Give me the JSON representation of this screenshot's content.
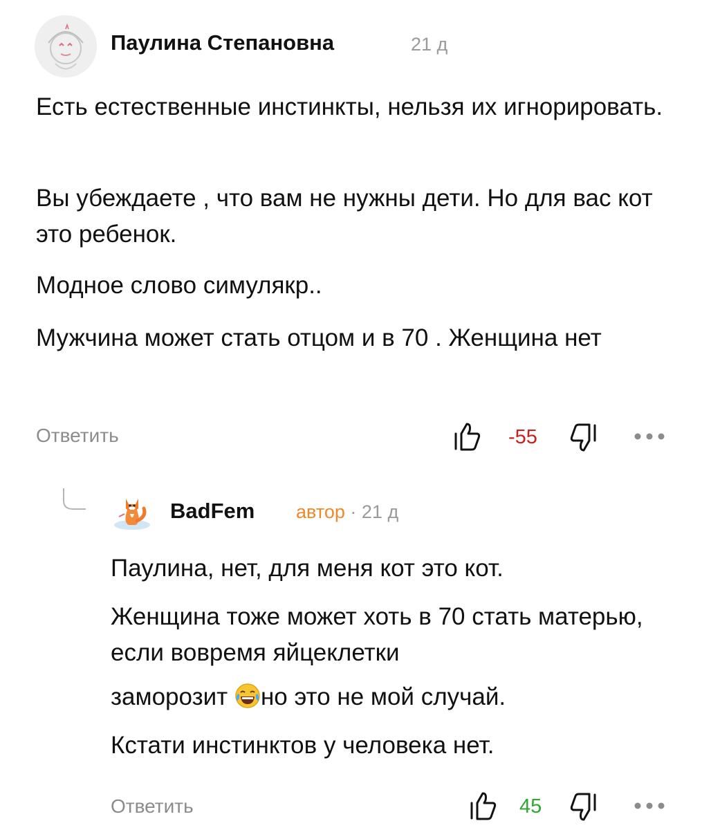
{
  "comment": {
    "author": "Паулина Степановна",
    "time": "21 д",
    "paragraphs": [
      "Есть естественные инстинкты, нельзя их игнорировать.",
      "Вы убеждаете , что вам не нужны дети. Но для вас кот это ребенок.",
      "Модное слово симулякр..",
      "Мужчина может стать отцом и в 70 . Женщина нет"
    ],
    "reply_label": "Ответить",
    "score": "-55",
    "score_color": "#cc1f1f",
    "more_icon": "more-dots-icon"
  },
  "reply": {
    "author": "BadFem",
    "badge": "автор",
    "separator": "·",
    "time": "21 д",
    "paragraphs": [
      "Паулина, нет, для меня кот это кот.",
      "Женщина тоже может хоть в 70 стать матерью, если вовремя яйцеклетки",
      "заморозит",
      "но это не мой случай.",
      "Кстати инстинктов у человека нет."
    ],
    "emoji": "face-with-tears-of-joy",
    "reply_label": "Ответить",
    "score": "45",
    "score_color": "#2ea82e",
    "more_icon": "more-dots-icon"
  },
  "colors": {
    "text": "#111111",
    "muted": "#8c8c8c",
    "author_badge": "#f0882a"
  }
}
